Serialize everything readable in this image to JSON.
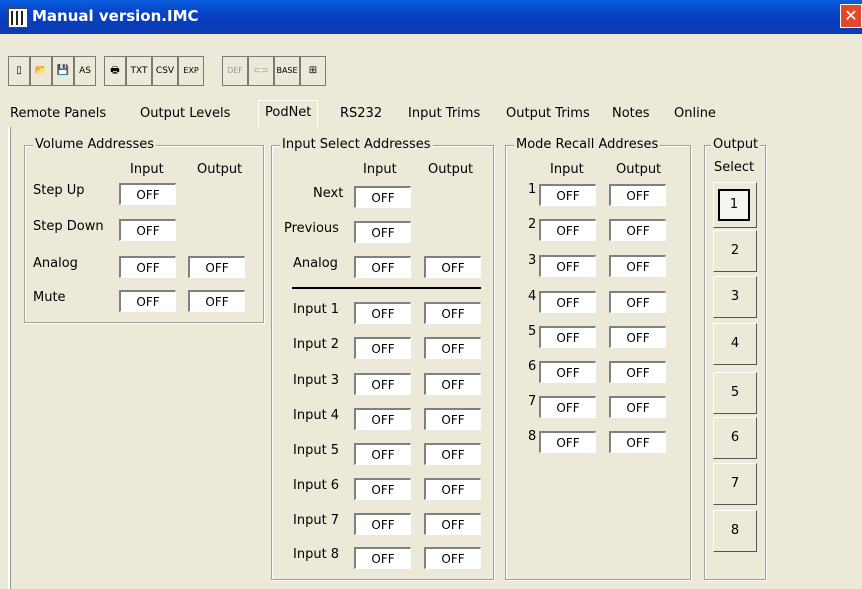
{
  "window": {
    "title": "Manual version.IMC",
    "close": "✕"
  },
  "toolbar": {
    "items": [
      {
        "name": "new-icon",
        "glyph": "▯"
      },
      {
        "name": "open-icon",
        "glyph": "📂"
      },
      {
        "name": "save-icon",
        "glyph": "💾"
      },
      {
        "name": "save-as-icon",
        "glyph": "AS"
      },
      {
        "name": "print-icon",
        "glyph": "🖶"
      },
      {
        "name": "txt-icon",
        "glyph": "TXT"
      },
      {
        "name": "csv-icon",
        "glyph": "CSV"
      },
      {
        "name": "export-icon",
        "glyph": "EXP"
      },
      {
        "name": "def-icon",
        "glyph": "DEF"
      },
      {
        "name": "link-icon",
        "glyph": "⊂⊃"
      },
      {
        "name": "base-icon",
        "glyph": "BASE"
      },
      {
        "name": "tree-icon",
        "glyph": "⊞"
      }
    ]
  },
  "tabs": [
    "Remote Panels",
    "Output Levels",
    "PodNet",
    "RS232",
    "Input Trims",
    "Output Trims",
    "Notes",
    "Online"
  ],
  "volume": {
    "title": "Volume Addresses",
    "col_input": "Input",
    "col_output": "Output",
    "rows": [
      {
        "label": "Step Up",
        "input": "OFF"
      },
      {
        "label": "Step Down",
        "input": "OFF"
      },
      {
        "label": "Analog",
        "input": "OFF",
        "output": "OFF"
      },
      {
        "label": "Mute",
        "input": "OFF",
        "output": "OFF"
      }
    ]
  },
  "input_select": {
    "title": "Input Select Addresses",
    "col_input": "Input",
    "col_output": "Output",
    "top": [
      {
        "label": "Next",
        "input": "OFF"
      },
      {
        "label": "Previous",
        "input": "OFF"
      },
      {
        "label": "Analog",
        "input": "OFF",
        "output": "OFF"
      }
    ],
    "inputs": [
      {
        "label": "Input 1",
        "input": "OFF",
        "output": "OFF"
      },
      {
        "label": "Input 2",
        "input": "OFF",
        "output": "OFF"
      },
      {
        "label": "Input 3",
        "input": "OFF",
        "output": "OFF"
      },
      {
        "label": "Input 4",
        "input": "OFF",
        "output": "OFF"
      },
      {
        "label": "Input 5",
        "input": "OFF",
        "output": "OFF"
      },
      {
        "label": "Input 6",
        "input": "OFF",
        "output": "OFF"
      },
      {
        "label": "Input 7",
        "input": "OFF",
        "output": "OFF"
      },
      {
        "label": "Input 8",
        "input": "OFF",
        "output": "OFF"
      }
    ]
  },
  "mode_recall": {
    "title": "Mode Recall Addreses",
    "col_input": "Input",
    "col_output": "Output",
    "rows": [
      {
        "num": "1",
        "input": "OFF",
        "output": "OFF"
      },
      {
        "num": "2",
        "input": "OFF",
        "output": "OFF"
      },
      {
        "num": "3",
        "input": "OFF",
        "output": "OFF"
      },
      {
        "num": "4",
        "input": "OFF",
        "output": "OFF"
      },
      {
        "num": "5",
        "input": "OFF",
        "output": "OFF"
      },
      {
        "num": "6",
        "input": "OFF",
        "output": "OFF"
      },
      {
        "num": "7",
        "input": "OFF",
        "output": "OFF"
      },
      {
        "num": "8",
        "input": "OFF",
        "output": "OFF"
      }
    ]
  },
  "output_select": {
    "title": "Output",
    "subtitle": "Select",
    "buttons": [
      "1",
      "2",
      "3",
      "4",
      "5",
      "6",
      "7",
      "8"
    ],
    "selected": "1"
  }
}
